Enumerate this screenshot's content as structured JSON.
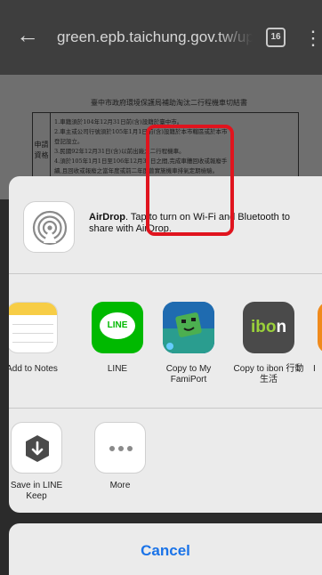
{
  "browser": {
    "url": "green.epb.taichung.gov.tw/up",
    "tab_count": "16",
    "back_glyph": "←",
    "menu_glyph": "⋮"
  },
  "document": {
    "title": "臺中市政府環境保護局補助淘汰二行程機車切結書",
    "side_label": "申請資格",
    "lines": [
      "1.車籍須於104年12月31日前(含)設籍於臺中市。",
      "2.車主或公司行號須於105年1月1日前(含)設籍於本市轄區或於本市",
      "  登記設立。",
      "3.民國92年12月31日(含)以前出廠之二行程機車。",
      "4.須於105年1月1日至106年12月31日之間,完成車體回收或報廢手",
      "  續,且回收或報廢之當年度或前二年度曾實施機車排氣定期檢驗。"
    ]
  },
  "share_sheet": {
    "airdrop": {
      "title": "AirDrop",
      "description": ". Tap to turn on Wi-Fi and Bluetooth to share with AirDrop.",
      "icon": "airdrop-icon"
    },
    "apps": [
      {
        "label": "Add to Notes",
        "icon": "notes-icon"
      },
      {
        "label": "LINE",
        "icon": "line-icon",
        "icon_text": "LINE"
      },
      {
        "label": "Copy to My FamiPort",
        "icon": "famiport-icon"
      },
      {
        "label": "Copy to ibon 行動生活",
        "icon": "ibon-icon",
        "icon_text_a": "ibo",
        "icon_text_b": "n"
      },
      {
        "label": "I",
        "icon": "app-icon"
      }
    ],
    "actions": [
      {
        "label": "Save in LINE Keep",
        "icon": "line-keep-icon"
      },
      {
        "label": "More",
        "icon": "more-icon"
      }
    ],
    "cancel_label": "Cancel"
  },
  "colors": {
    "highlight": "#e0141e",
    "cancel_text": "#1a73e8",
    "line_green": "#00b900"
  }
}
